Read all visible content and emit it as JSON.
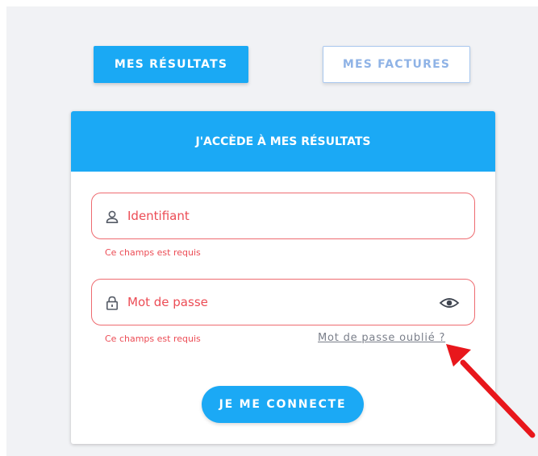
{
  "tabs": {
    "results_label": "MES RÉSULTATS",
    "invoices_label": "MES FACTURES"
  },
  "card": {
    "title": "J'ACCÈDE À MES RÉSULTATS"
  },
  "login": {
    "username_placeholder": "Identifiant",
    "username_value": "",
    "username_error": "Ce champs est requis",
    "password_placeholder": "Mot de passe",
    "password_value": "",
    "password_error": "Ce champs est requis",
    "forgot_password_label": "Mot de passe oublié ?",
    "submit_label": "JE ME CONNECTE"
  },
  "icons": {
    "username": "user-icon",
    "password": "lock-icon",
    "show_password": "eye-icon",
    "annotation": "red-arrow"
  },
  "colors": {
    "accent": "#1ba9f5",
    "error": "#ec4c55",
    "annotation": "#e8171c",
    "background": "#f1f2f5"
  }
}
